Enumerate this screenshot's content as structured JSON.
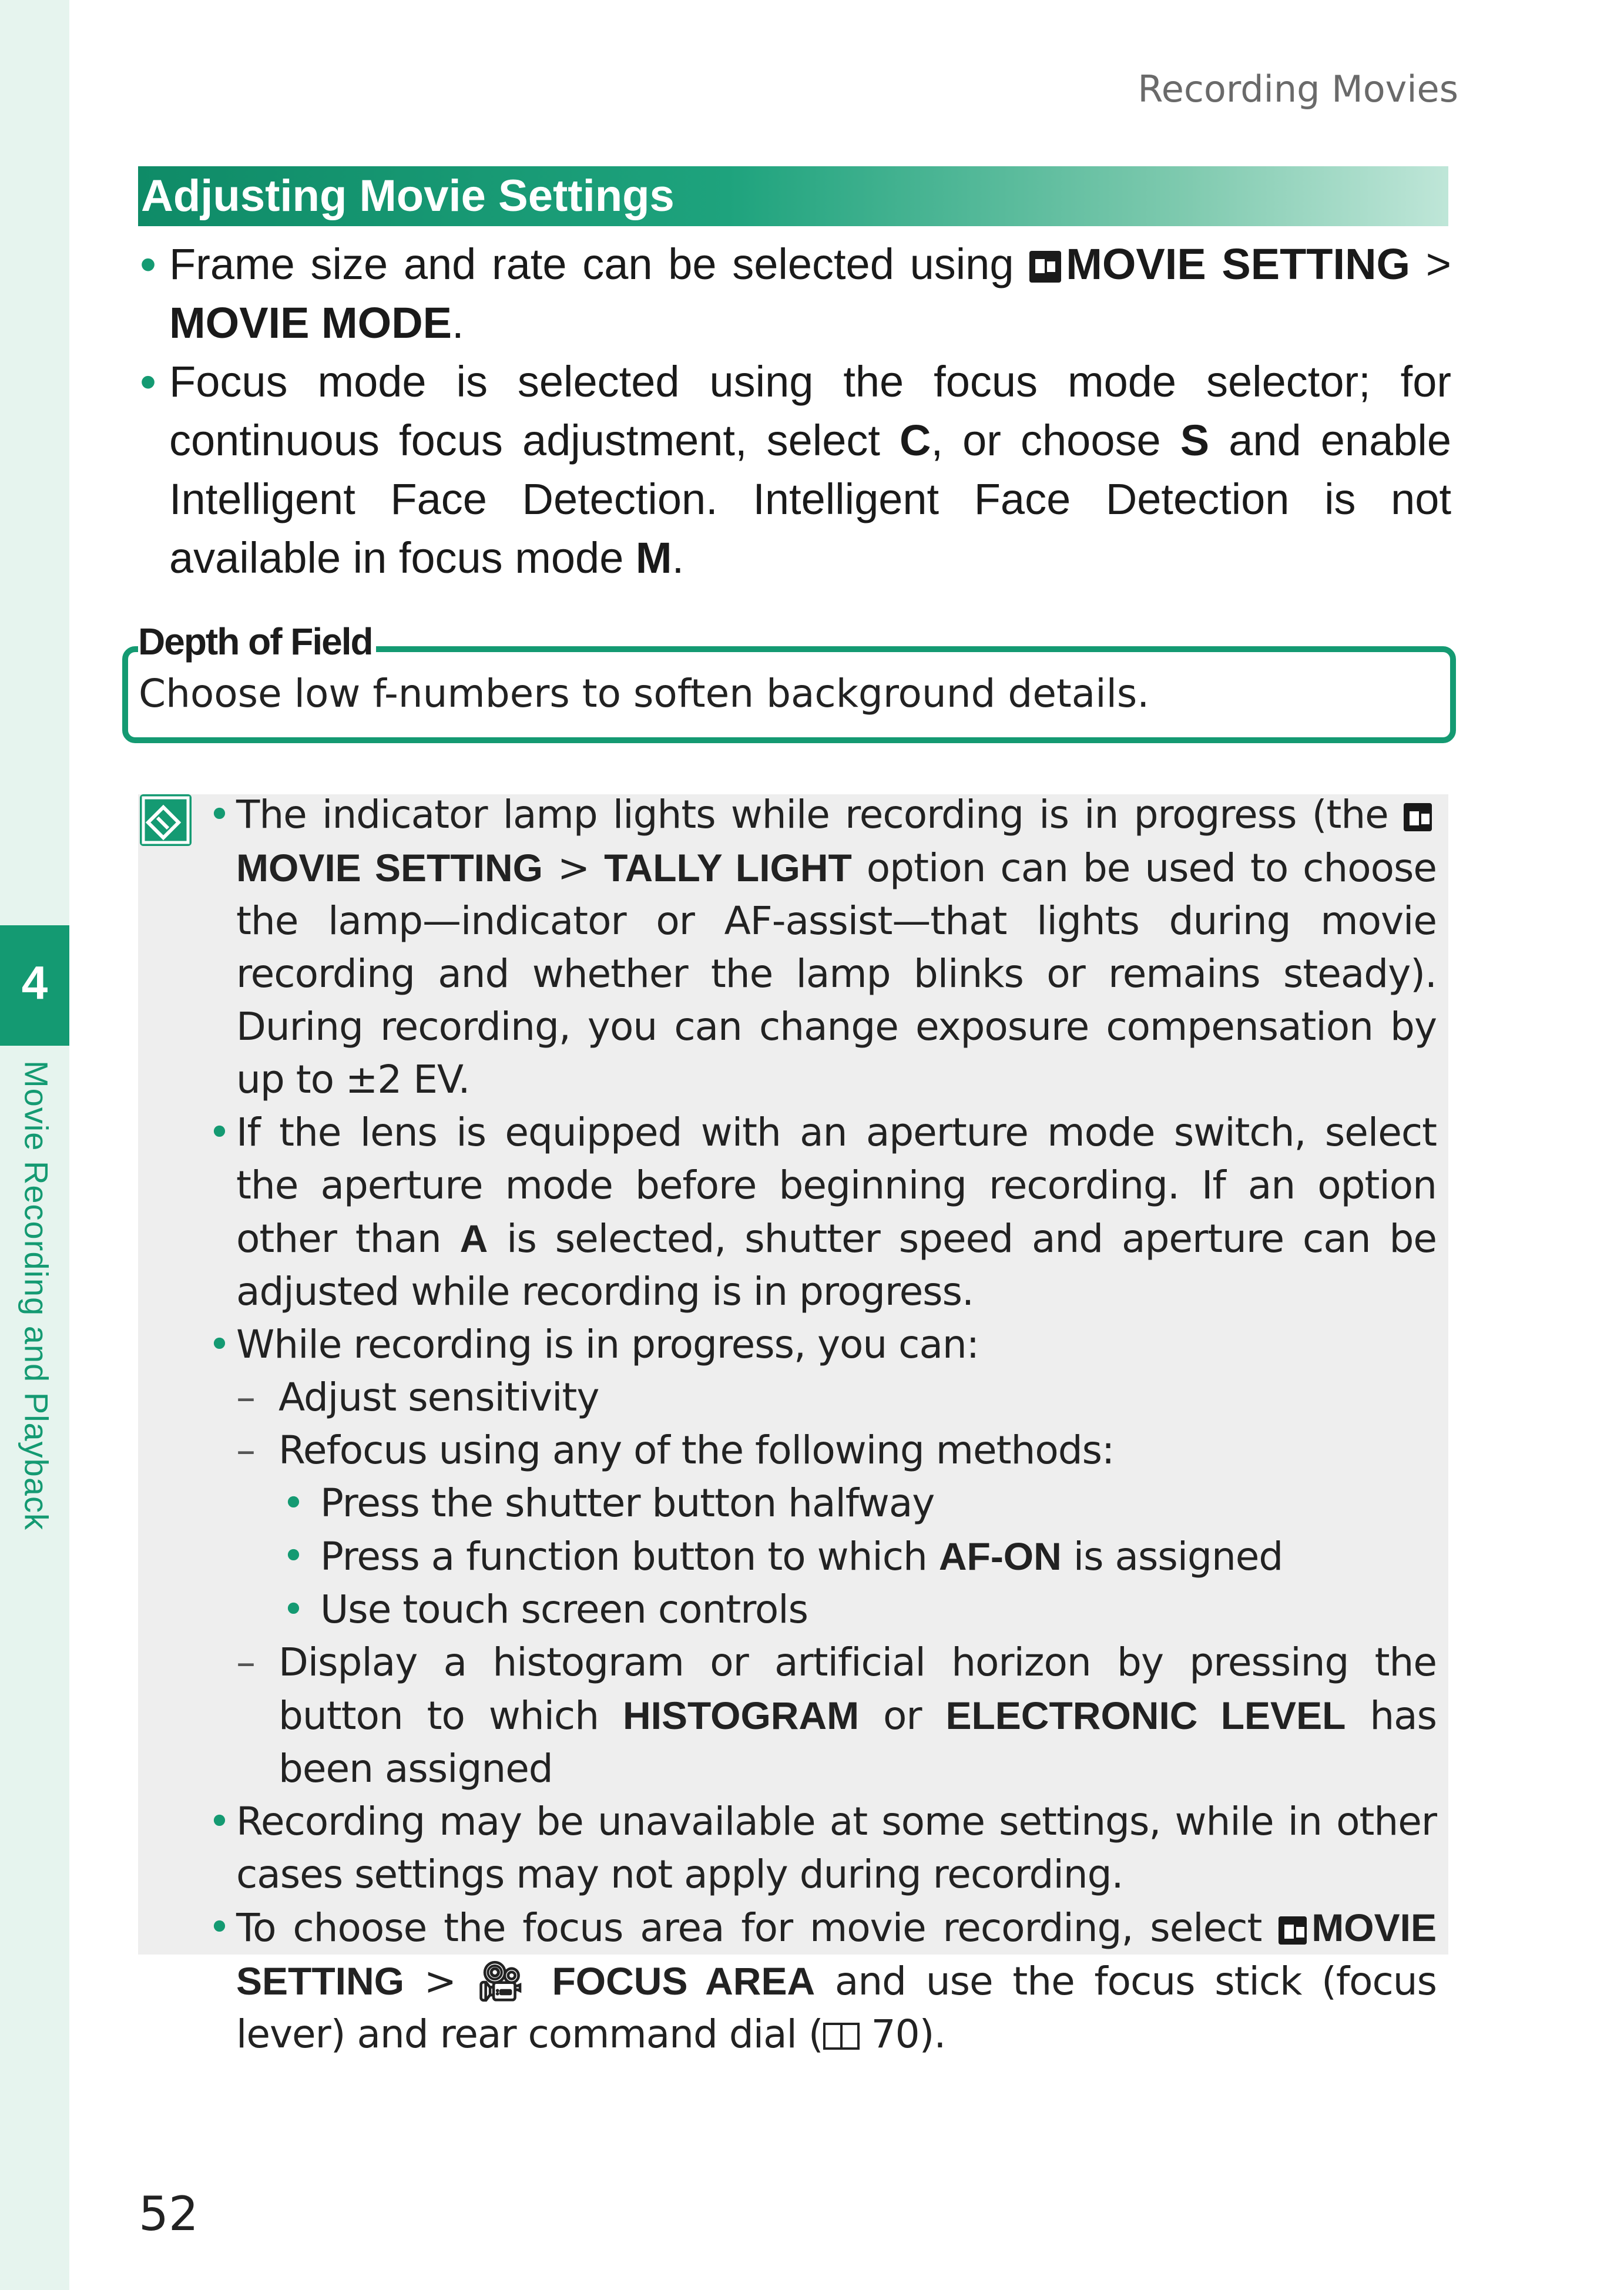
{
  "header": {
    "title": "Recording Movies"
  },
  "sidebar": {
    "chapter_number": "4",
    "chapter_title": "Movie Recording and Playback"
  },
  "section": {
    "title": "Adjusting Movie Settings"
  },
  "bullets": {
    "b1": {
      "t1": "Frame size and rate can be selected using ",
      "k1": "MOVIE SETTING",
      "t2": " > ",
      "k2": "MOVIE MODE",
      "t3": "."
    },
    "b2": {
      "t1": "Focus mode is selected using the focus mode selector; for continuous focus adjustment, select ",
      "k1": "C",
      "t2": ", or choose ",
      "k2": "S",
      "t3": " and enable Intelligent Face Detection. Intelligent Face Detection is not available in focus mode ",
      "k3": "M",
      "t4": "."
    }
  },
  "depth_of_field": {
    "title": "Depth of Field",
    "text": "Choose low f-numbers to soften background details."
  },
  "notes": {
    "n1": {
      "t1": "The indicator lamp lights while recording is in progress (the ",
      "k1": "MOVIE SETTING",
      "t2": " > ",
      "k2": "TALLY LIGHT",
      "t3": " option can be used to choose the lamp—indicator or AF-assist—that lights during movie recording and whether the lamp blinks or remains steady). During recording, you can change exposure compensation by up to ±2 EV."
    },
    "n2": {
      "t1": "If the lens is equipped with an aperture mode switch, select the aperture mode before beginning recording. If an option other than ",
      "k1": "A",
      "t2": " is selected, shutter speed and aperture can be adjusted while recording is in progress."
    },
    "n3": {
      "text": "While recording is in progress, you can:",
      "sub1": "Adjust sensitivity",
      "sub2": "Refocus using any of the following methods:",
      "m1": "Press the shutter button halfway",
      "m2": {
        "t1": "Press a function button to which ",
        "k1": "AF-ON",
        "t2": " is assigned"
      },
      "m3": "Use touch screen controls",
      "sub3": {
        "t1": "Display a histogram or artificial horizon by pressing the button to which ",
        "k1": "HISTOGRAM",
        "t2": " or ",
        "k2": "ELECTRONIC LEVEL",
        "t3": " has been assigned"
      }
    },
    "n4": "Recording may be unavailable at some settings, while in other cases settings may not apply during recording.",
    "n5": {
      "t1": "To choose the focus area for movie recording, select ",
      "k1": "MOVIE SETTING",
      "t2": " > ",
      "k2": "FOCUS AREA",
      "t3": " and use the focus stick (focus lever) and rear command dial (",
      "t4": " 70)."
    }
  },
  "footer": {
    "page_number": "52"
  },
  "icons": {
    "movie_setting": "movie-camera-icon",
    "book": "book-icon",
    "note": "note-icon"
  },
  "colors": {
    "accent": "#149a72",
    "sidebar_bg": "#e6f4ee",
    "note_bg": "#eeeeee"
  }
}
